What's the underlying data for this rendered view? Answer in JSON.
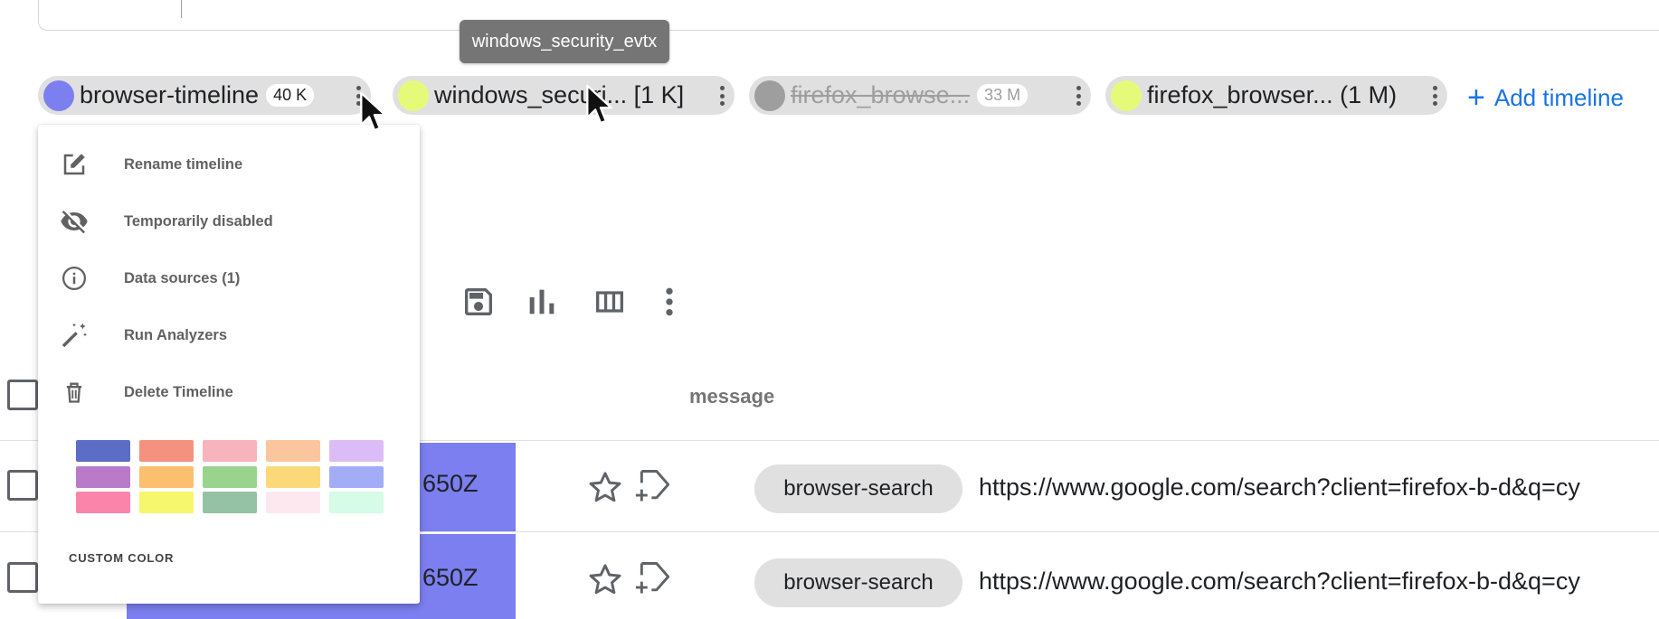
{
  "tooltip": {
    "text": "windows_security_evtx"
  },
  "timelines": [
    {
      "name": "browser-timeline",
      "count": "40 K",
      "color": "#7b7ff0",
      "disabled": false
    },
    {
      "name": "windows_securi... [1 K]",
      "count": "",
      "color": "#e6fa7a",
      "disabled": false
    },
    {
      "name": "firefox_browse...",
      "count": "33 M",
      "color": "#9e9e9e",
      "disabled": true
    },
    {
      "name": "firefox_browser... (1 M)",
      "count": "",
      "color": "#e6fa7a",
      "disabled": false
    }
  ],
  "add_timeline": {
    "label": "Add timeline",
    "icon": "plus-icon"
  },
  "toolbar": {
    "icons": [
      "save-icon",
      "bar-chart-icon",
      "columns-icon",
      "more-vert-icon"
    ]
  },
  "table": {
    "message_header": "message",
    "rows": [
      {
        "date_fragment": "650Z",
        "tag": "browser-search",
        "message": "https://www.google.com/search?client=firefox-b-d&q=cy"
      },
      {
        "date_fragment": "650Z",
        "tag": "browser-search",
        "message": "https://www.google.com/search?client=firefox-b-d&q=cy"
      }
    ]
  },
  "menu": {
    "items": [
      {
        "label": "Rename timeline",
        "icon": "edit-icon"
      },
      {
        "label": "Temporarily disabled",
        "icon": "visibility-off-icon"
      },
      {
        "label": "Data sources (1)",
        "icon": "info-icon"
      },
      {
        "label": "Run Analyzers",
        "icon": "magic-wand-icon"
      },
      {
        "label": "Delete Timeline",
        "icon": "trash-icon"
      }
    ],
    "swatches": [
      "#5b6dc4",
      "#f4917f",
      "#f8b4bd",
      "#fbc59e",
      "#dcbcf7",
      "#b97ac8",
      "#fbbf6d",
      "#99d38e",
      "#fcd978",
      "#a3adf7",
      "#fb85aa",
      "#f7f76d",
      "#95c1a4",
      "#fde8ef",
      "#d6fbe6"
    ],
    "custom_color_label": "CUSTOM COLOR"
  }
}
